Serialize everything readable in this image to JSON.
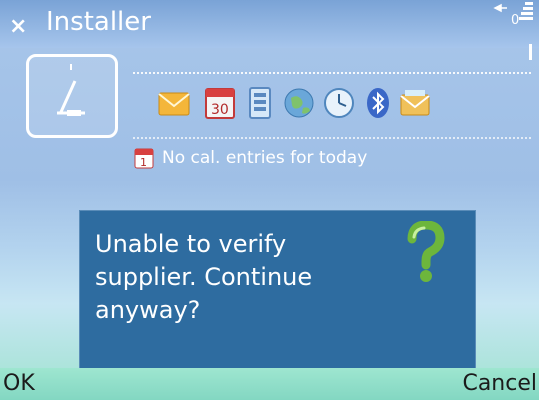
{
  "header": {
    "title": "Installer"
  },
  "shortcuts": [
    {
      "name": "messaging-icon"
    },
    {
      "name": "calendar-icon",
      "label": "30"
    },
    {
      "name": "contacts-icon"
    },
    {
      "name": "globe-icon"
    },
    {
      "name": "clock-icon"
    },
    {
      "name": "bluetooth-icon"
    },
    {
      "name": "email-icon"
    }
  ],
  "calendar": {
    "text": "No cal. entries for today",
    "icon_day": "1"
  },
  "dialog": {
    "message": "Unable to verify supplier. Continue anyway?",
    "icon": "question-icon"
  },
  "softkeys": {
    "left": "OK",
    "right": "Cancel"
  },
  "colors": {
    "dialog_bg": "#2e6ca0",
    "softkey_bar": "#9ee6d0"
  }
}
